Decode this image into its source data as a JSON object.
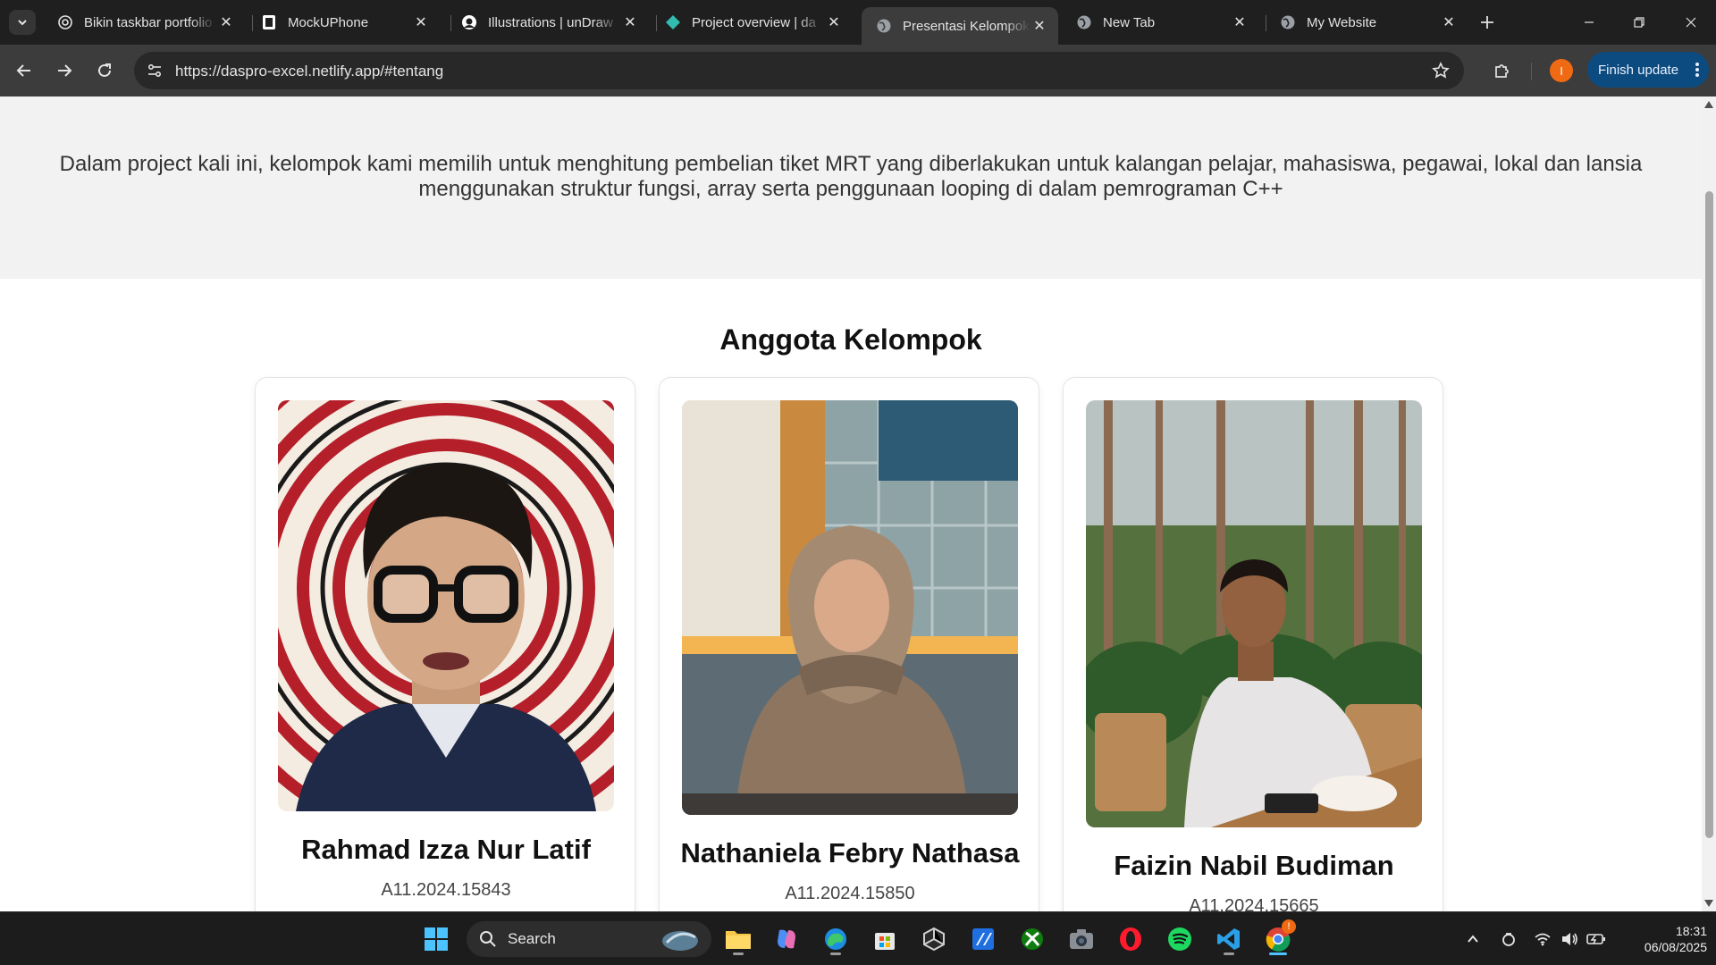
{
  "browser": {
    "tabs": [
      {
        "title": "Bikin taskbar portfolio",
        "icon": "openai-icon",
        "active": false
      },
      {
        "title": "MockUPhone",
        "icon": "mockuphone-icon",
        "active": false
      },
      {
        "title": "Illustrations | unDraw",
        "icon": "undraw-icon",
        "active": false
      },
      {
        "title": "Project overview | da",
        "icon": "netlify-icon",
        "active": false
      },
      {
        "title": "Presentasi Kelompok",
        "icon": "globe-icon",
        "active": true
      },
      {
        "title": "New Tab",
        "icon": "globe-icon",
        "active": false
      },
      {
        "title": "My Website",
        "icon": "globe-icon",
        "active": false
      }
    ],
    "url": "https://daspro-excel.netlify.app/#tentang",
    "profile_initial": "I",
    "finish_update_label": "Finish update"
  },
  "page": {
    "about_text": "Dalam project kali ini, kelompok kami memilih untuk menghitung pembelian tiket MRT yang diberlakukan untuk kalangan pelajar, mahasiswa, pegawai, lokal dan lansia menggunakan struktur fungsi, array serta penggunaan looping di dalam pemrograman C++",
    "members_title": "Anggota Kelompok",
    "members": [
      {
        "name": "Rahmad Izza Nur Latif",
        "nim": "A11.2024.15843"
      },
      {
        "name": "Nathaniela Febry Nathasa",
        "nim": "A11.2024.15850"
      },
      {
        "name": "Faizin Nabil Budiman",
        "nim": "A11.2024.15665"
      }
    ]
  },
  "taskbar": {
    "search_placeholder": "Search",
    "time": "18:31",
    "date": "06/08/2025",
    "chrome_badge": "!",
    "colors": {
      "accent": "#4cc2ff",
      "taskbar_bg": "#1c1c1c"
    }
  }
}
